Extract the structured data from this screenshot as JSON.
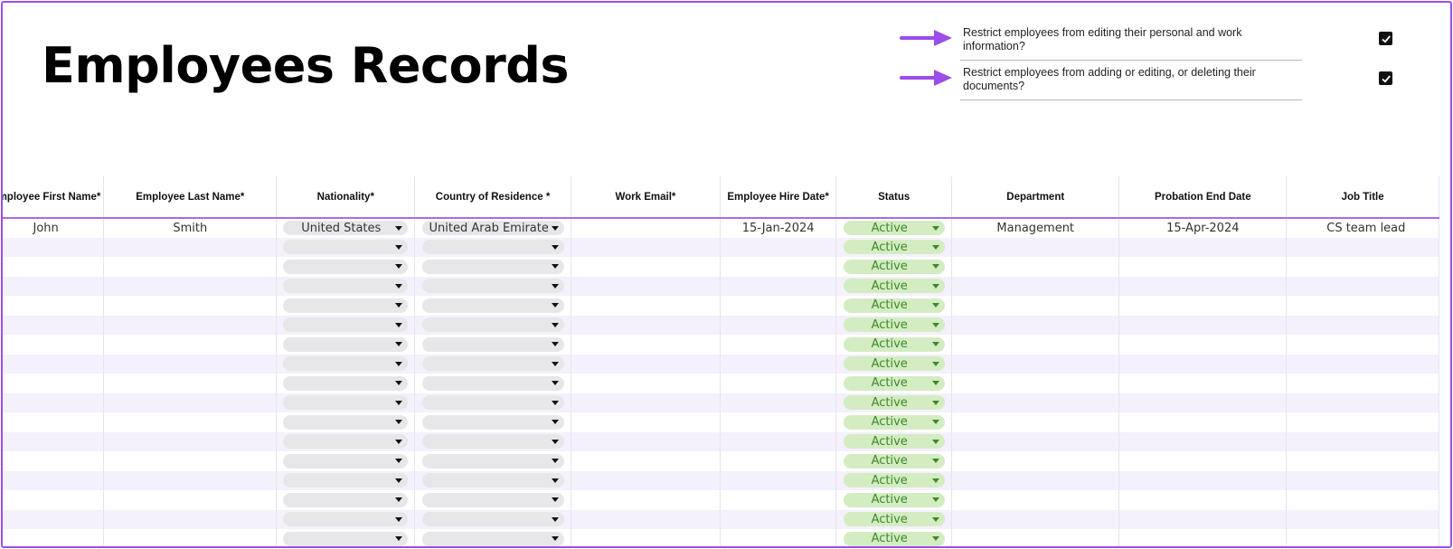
{
  "page": {
    "title": "Employees Records",
    "accent": "#9b4de8"
  },
  "settings": [
    {
      "text": "Restrict employees from editing their personal and work information?",
      "checked": true
    },
    {
      "text": "Restrict employees from adding or editing, or deleting their documents?",
      "checked": true
    }
  ],
  "table": {
    "columns": [
      "Employee First Name*",
      "Employee Last Name*",
      "Nationality*",
      "Country of Residence *",
      "Work Email*",
      "Employee Hire Date*",
      "Status",
      "Department",
      "Probation End Date",
      "Job Title"
    ],
    "first_row": {
      "first_name": "John",
      "last_name": "Smith",
      "nationality": "United States",
      "country": "United Arab Emirates",
      "email": "",
      "hire_date": "15-Jan-2024",
      "status": "Active",
      "department": "Management",
      "probation_end": "15-Apr-2024",
      "job_title": "CS team lead"
    },
    "empty_status": "Active",
    "colors": {
      "status_bg": "#d4ecc2",
      "status_text": "#3a8a2a",
      "row_alt": "#f4f0fc"
    }
  }
}
